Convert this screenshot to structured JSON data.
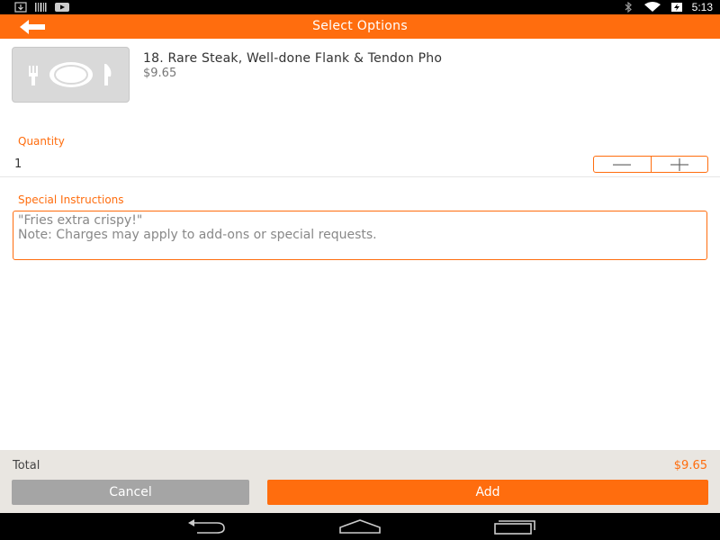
{
  "status_bar": {
    "time": "5:13",
    "left_icons": [
      "download-icon",
      "barcode-icon",
      "video-icon"
    ],
    "right_icons": [
      "bluetooth-icon",
      "wifi-icon",
      "battery-charging-icon"
    ]
  },
  "app_bar": {
    "title": "Select Options",
    "back_icon": "back-arrow-icon"
  },
  "item": {
    "name": "18. Rare Steak, Well-done Flank & Tendon Pho",
    "price": "$9.65",
    "thumbnail_icon": "fork-plate-knife-icon"
  },
  "quantity": {
    "label": "Quantity",
    "value": "1",
    "decrement_icon": "minus-icon",
    "increment_icon": "plus-icon"
  },
  "special_instructions": {
    "label": "Special Instructions",
    "placeholder": "\"Fries extra crispy!\"\nNote: Charges may apply to add-ons or special requests."
  },
  "footer": {
    "total_label": "Total",
    "total_value": "$9.65",
    "cancel_label": "Cancel",
    "add_label": "Add"
  },
  "colors": {
    "accent": "#ff6d0e",
    "cancel": "#a5a5a5",
    "footer_bg": "#e9e6e1"
  },
  "nav_bar": {
    "buttons": [
      "back-nav-icon",
      "home-nav-icon",
      "recents-nav-icon"
    ]
  }
}
